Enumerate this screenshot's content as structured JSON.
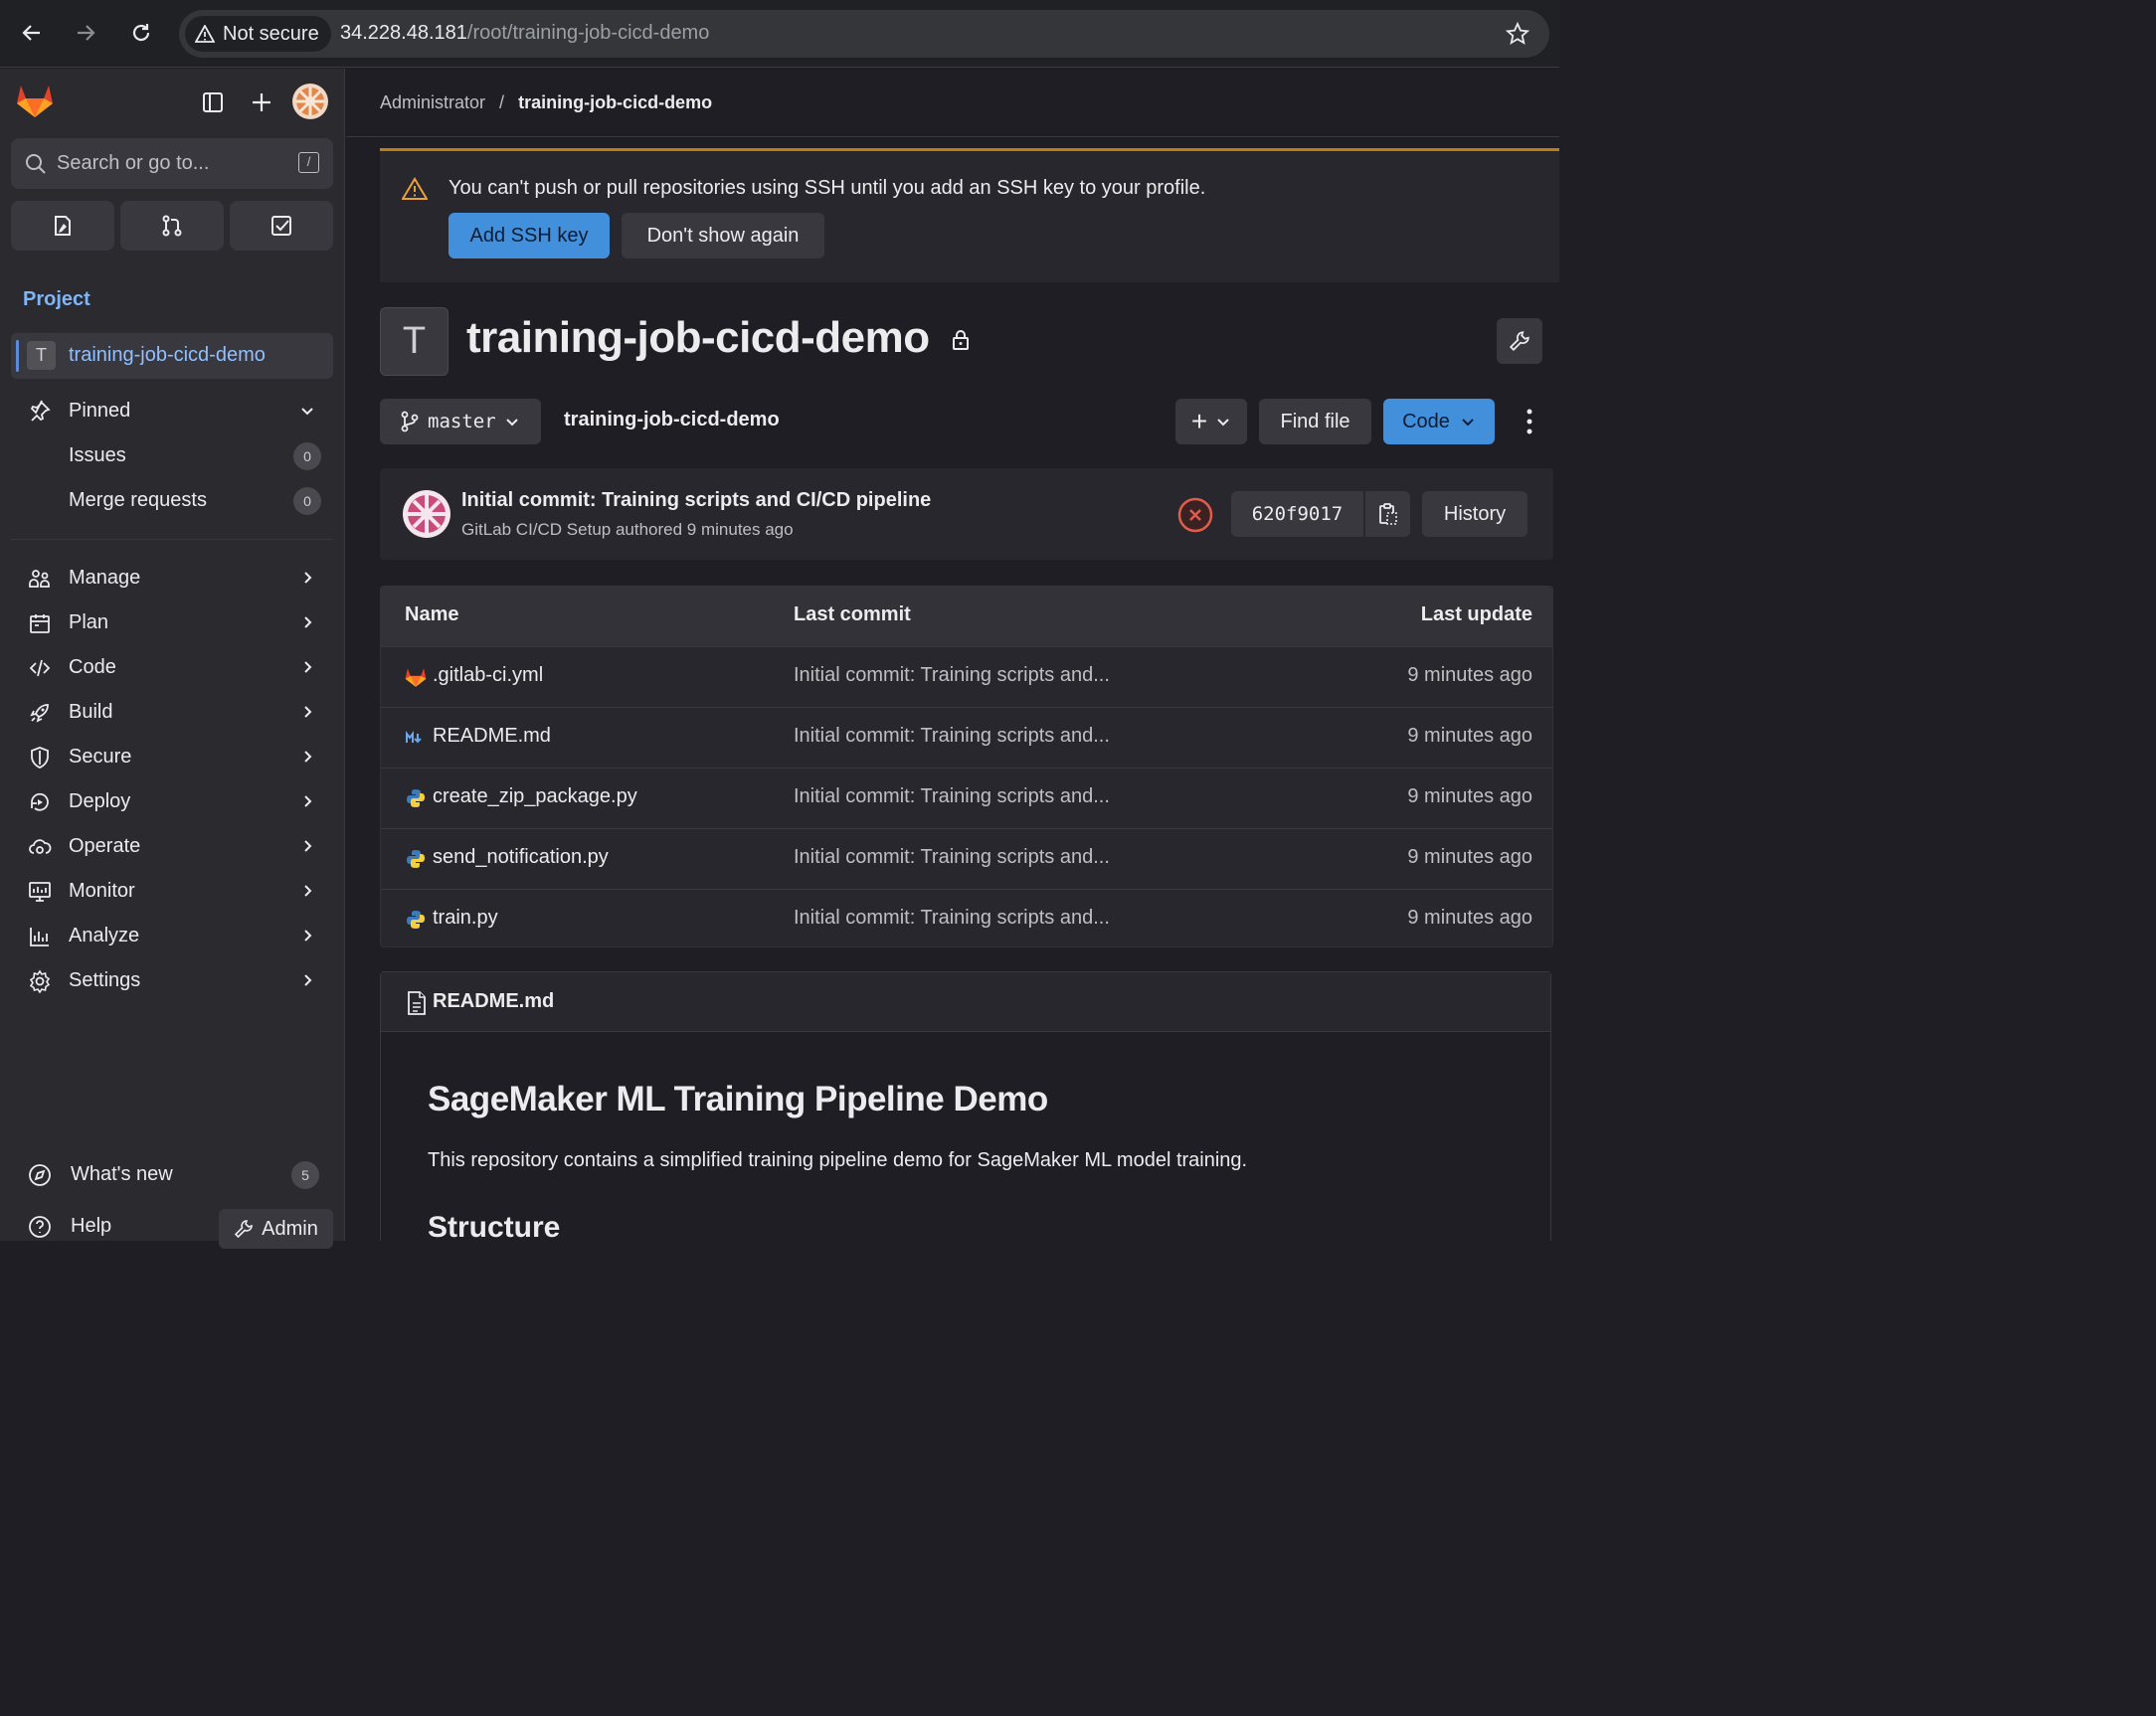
{
  "browser": {
    "security_label": "Not secure",
    "url_host": "34.228.48.181",
    "url_path": "/root/training-job-cicd-demo"
  },
  "sidebar": {
    "search_placeholder": "Search or go to...",
    "search_shortcut": "/",
    "section_title": "Project",
    "project": {
      "avatar_letter": "T",
      "name": "training-job-cicd-demo"
    },
    "pinned": {
      "label": "Pinned",
      "items": [
        {
          "label": "Issues",
          "count": "0"
        },
        {
          "label": "Merge requests",
          "count": "0"
        }
      ]
    },
    "nav": [
      {
        "label": "Manage",
        "icon": "users-icon"
      },
      {
        "label": "Plan",
        "icon": "calendar-icon"
      },
      {
        "label": "Code",
        "icon": "code-icon"
      },
      {
        "label": "Build",
        "icon": "rocket-icon"
      },
      {
        "label": "Secure",
        "icon": "shield-icon"
      },
      {
        "label": "Deploy",
        "icon": "deploy-icon"
      },
      {
        "label": "Operate",
        "icon": "cloud-gear-icon"
      },
      {
        "label": "Monitor",
        "icon": "monitor-icon"
      },
      {
        "label": "Analyze",
        "icon": "chart-icon"
      },
      {
        "label": "Settings",
        "icon": "gear-icon"
      }
    ],
    "whats_new": {
      "label": "What's new",
      "count": "5"
    },
    "help_label": "Help",
    "admin_label": "Admin"
  },
  "main": {
    "breadcrumb": {
      "parent": "Administrator",
      "separator": "/",
      "current": "training-job-cicd-demo"
    },
    "alert": {
      "text": "You can't push or pull repositories using SSH until you add an SSH key to your profile.",
      "primary_button": "Add SSH key",
      "secondary_button": "Don't show again"
    },
    "project": {
      "avatar_letter": "T",
      "title": "training-job-cicd-demo"
    },
    "toolbar": {
      "branch": "master",
      "path": "training-job-cicd-demo",
      "add_label": "+",
      "find_file_label": "Find file",
      "code_label": "Code"
    },
    "commit": {
      "title": "Initial commit: Training scripts and CI/CD pipeline",
      "author_line": "GitLab CI/CD Setup authored 9 minutes ago",
      "sha": "620f9017",
      "history_label": "History",
      "status": "failed"
    },
    "files": {
      "headers": {
        "name": "Name",
        "last_commit": "Last commit",
        "last_update": "Last update"
      },
      "rows": [
        {
          "name": ".gitlab-ci.yml",
          "icon": "gitlab-icon",
          "commit": "Initial commit: Training scripts and...",
          "updated": "9 minutes ago"
        },
        {
          "name": "README.md",
          "icon": "markdown-icon",
          "commit": "Initial commit: Training scripts and...",
          "updated": "9 minutes ago"
        },
        {
          "name": "create_zip_package.py",
          "icon": "python-icon",
          "commit": "Initial commit: Training scripts and...",
          "updated": "9 minutes ago"
        },
        {
          "name": "send_notification.py",
          "icon": "python-icon",
          "commit": "Initial commit: Training scripts and...",
          "updated": "9 minutes ago"
        },
        {
          "name": "train.py",
          "icon": "python-icon",
          "commit": "Initial commit: Training scripts and...",
          "updated": "9 minutes ago"
        }
      ]
    },
    "readme": {
      "filename": "README.md",
      "h1": "SageMaker ML Training Pipeline Demo",
      "paragraph": "This repository contains a simplified training pipeline demo for SageMaker ML model training.",
      "h2": "Structure"
    }
  },
  "colors": {
    "accent_blue": "#428fdc",
    "warning": "#c17d10",
    "danger": "#e05c4c",
    "link": "#8fc0ff"
  }
}
